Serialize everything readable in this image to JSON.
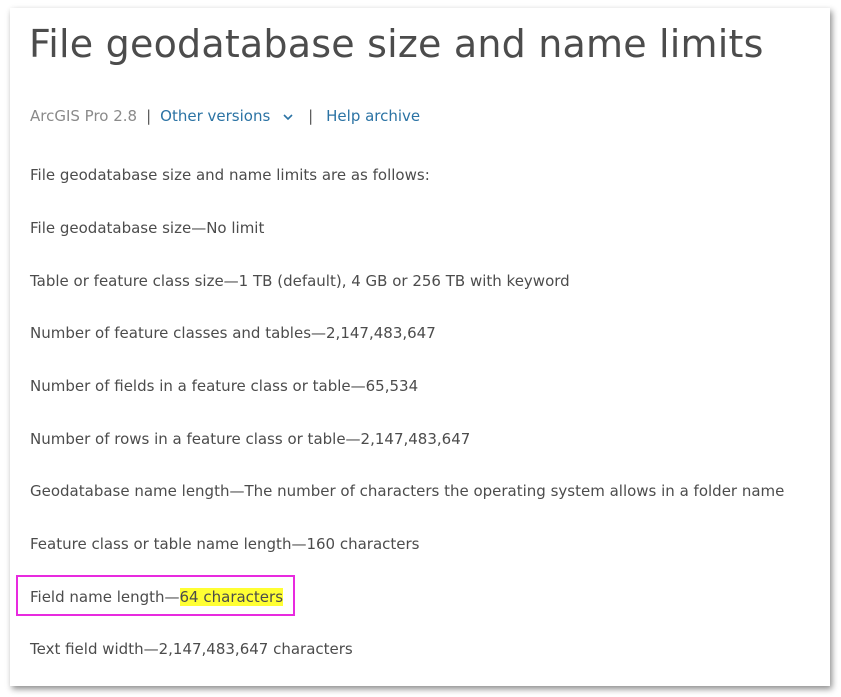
{
  "page": {
    "title": "File geodatabase size and name limits"
  },
  "versionbar": {
    "product": "ArcGIS Pro 2.8",
    "separator": "|",
    "other_versions": "Other versions",
    "help_archive": "Help archive"
  },
  "content": {
    "intro": "File geodatabase size and name limits are as follows:",
    "limits": [
      "File geodatabase size—No limit",
      "Table or feature class size—1 TB (default), 4 GB or 256 TB with keyword",
      "Number of feature classes and tables—2,147,483,647",
      "Number of fields in a feature class or table—65,534",
      "Number of rows in a feature class or table—2,147,483,647",
      "Geodatabase name length—The number of characters the operating system allows in a folder name",
      "Feature class or table name length—160 characters"
    ],
    "field_name": {
      "prefix": "Field name length—",
      "highlighted": "64 characters"
    },
    "text_field": "Text field width—2,147,483,647 characters"
  },
  "colors": {
    "highlight": "#ffff33",
    "annotation_box": "#e82adf",
    "link": "#2b73a4"
  }
}
